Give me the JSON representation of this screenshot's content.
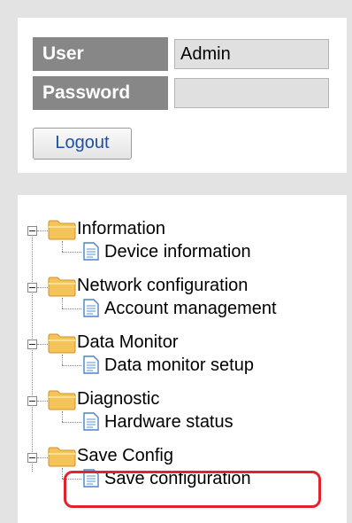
{
  "login": {
    "user_label": "User",
    "user_value": "Admin",
    "password_label": "Password",
    "password_value": "",
    "logout_label": "Logout"
  },
  "tree": {
    "groups": [
      {
        "folder": "Information",
        "item": "Device information"
      },
      {
        "folder": "Network configuration",
        "item": "Account management"
      },
      {
        "folder": "Data Monitor",
        "item": "Data monitor setup"
      },
      {
        "folder": "Diagnostic",
        "item": "Hardware status"
      },
      {
        "folder": "Save Config",
        "item": "Save configuration"
      }
    ],
    "highlighted_item": "Save configuration",
    "highlight_color": "#e0232f",
    "folder_color": "#f6c35a",
    "document_color": "#4a83c9"
  }
}
